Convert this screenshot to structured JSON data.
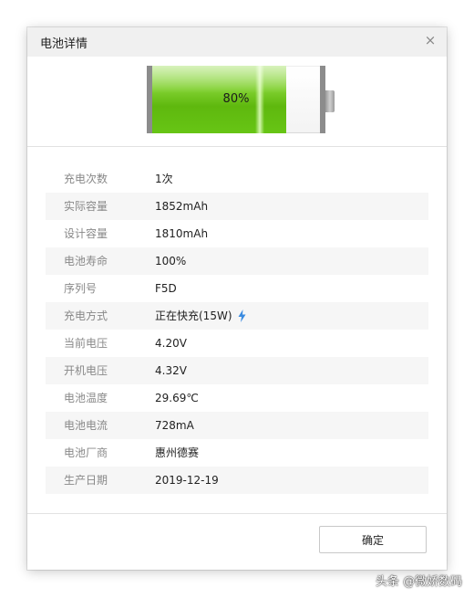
{
  "window": {
    "title": "电池详情",
    "close_icon": "×"
  },
  "battery": {
    "percent_label": "80%",
    "level": 0.8,
    "fill_color": "#67c515",
    "shell_color": "#8c8c8c"
  },
  "details": [
    {
      "key": "充电次数",
      "value": "1次"
    },
    {
      "key": "实际容量",
      "value": "1852mAh"
    },
    {
      "key": "设计容量",
      "value": "1810mAh"
    },
    {
      "key": "电池寿命",
      "value": "100%"
    },
    {
      "key": "序列号",
      "value": "F5D"
    },
    {
      "key": "充电方式",
      "value": "正在快充(15W)",
      "icon": "lightning-icon",
      "icon_color": "#3b8be0"
    },
    {
      "key": "当前电压",
      "value": "4.20V"
    },
    {
      "key": "开机电压",
      "value": "4.32V"
    },
    {
      "key": "电池温度",
      "value": "29.69℃"
    },
    {
      "key": "电池电流",
      "value": "728mA"
    },
    {
      "key": "电池厂商",
      "value": "惠州德赛"
    },
    {
      "key": "生产日期",
      "value": "2019-12-19"
    }
  ],
  "footer": {
    "ok_label": "确定"
  },
  "watermark": "头条 @微娇数码"
}
